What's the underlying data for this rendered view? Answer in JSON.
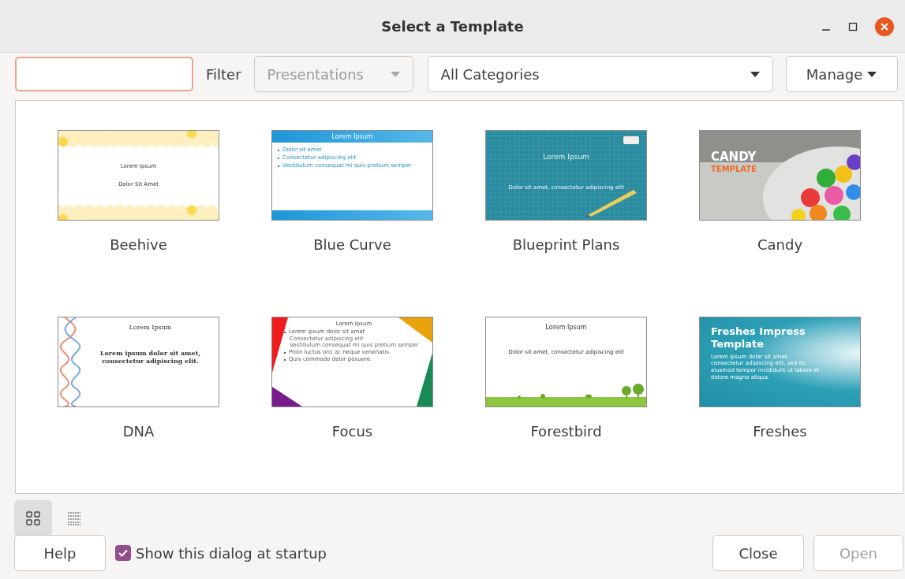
{
  "window": {
    "title": "Select a Template"
  },
  "toolbar": {
    "filter_label": "Filter",
    "type_filter": {
      "value": "Presentations",
      "disabled": true
    },
    "category_filter": {
      "value": "All Categories"
    },
    "manage_button": "Manage"
  },
  "templates": [
    {
      "name": "Beehive",
      "preview": {
        "kind": "beehive",
        "title": "Lorem Ipsum",
        "lines": [
          {
            "text": "Dolor Sit Amet"
          }
        ]
      }
    },
    {
      "name": "Blue Curve",
      "preview": {
        "kind": "bluecurve",
        "title": "Lorem Ipsum",
        "lines": [
          {
            "text": "Dolor sit amet"
          },
          {
            "text": "Consectetur adipiscing elit"
          },
          {
            "text": "Vestibulum consequat mi quis pretium semper"
          }
        ]
      }
    },
    {
      "name": "Blueprint Plans",
      "preview": {
        "kind": "blueprint",
        "title": "Lorem Ipsum",
        "lines": [
          {
            "text": "Dolor sit amet, consectetur adipiscing elit"
          }
        ]
      }
    },
    {
      "name": "Candy",
      "preview": {
        "kind": "candy",
        "title": "CANDY",
        "lines": [
          {
            "text": "TEMPLATE"
          }
        ]
      }
    },
    {
      "name": "DNA",
      "preview": {
        "kind": "dna",
        "title": "Lorem Ipsum",
        "lines": [
          {
            "text": "Lorem ipsum dolor sit amet, consectetur adipiscing elit."
          }
        ]
      }
    },
    {
      "name": "Focus",
      "preview": {
        "kind": "focus",
        "title": "Lorem Ipsum",
        "lines": [
          {
            "text": "Lorem ipsum dolor sit amet",
            "children": [
              {
                "text": "Consectetur adipiscing elit"
              },
              {
                "text": "Vestibulum consequat mi quis pretium semper"
              }
            ]
          },
          {
            "text": "Proin luctus orci ac neque venenatis"
          },
          {
            "text": "Quis commodo dolor posuere."
          }
        ]
      }
    },
    {
      "name": "Forestbird",
      "preview": {
        "kind": "forestbird",
        "title": "Lorem Ipsum",
        "lines": [
          {
            "text": "Dolor sit amet, consectetur adipiscing elit"
          }
        ]
      }
    },
    {
      "name": "Freshes",
      "preview": {
        "kind": "freshes",
        "title": "Freshes Impress Template",
        "lines": [
          {
            "text": "Lorem ipsum dolor sit amet, consectetur adipiscing elit, sed do eiusmod tempor incididunt ut labore et dolore magna aliqua."
          }
        ]
      }
    }
  ],
  "view_modes": [
    {
      "kind": "grid",
      "selected": true
    },
    {
      "kind": "list",
      "selected": false
    }
  ],
  "footer": {
    "help_button": "Help",
    "startup_checkbox": {
      "label": "Show this dialog at startup",
      "checked": true
    },
    "close_button": "Close",
    "open_button": {
      "label": "Open",
      "disabled": true
    }
  }
}
